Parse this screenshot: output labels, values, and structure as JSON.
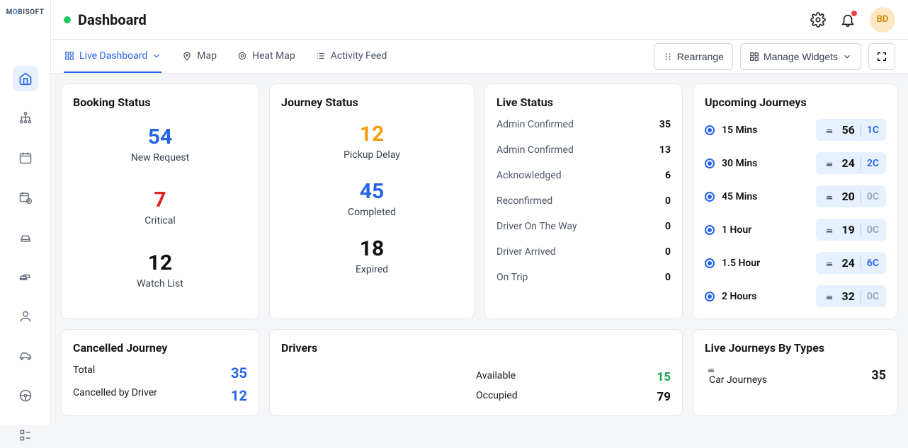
{
  "header": {
    "title": "Dashboard",
    "avatar": "BD"
  },
  "tabs": [
    {
      "label": "Live Dashboard"
    },
    {
      "label": "Map"
    },
    {
      "label": "Heat Map"
    },
    {
      "label": "Activity Feed"
    }
  ],
  "rearrange_label": "Rearrange",
  "manage_widgets_label": "Manage Widgets",
  "booking": {
    "title": "Booking Status",
    "items": [
      {
        "value": "54",
        "label": "New Request",
        "cls": "blue"
      },
      {
        "value": "7",
        "label": "Critical",
        "cls": "red"
      },
      {
        "value": "12",
        "label": "Watch List",
        "cls": "black"
      }
    ]
  },
  "journey": {
    "title": "Journey Status",
    "items": [
      {
        "value": "12",
        "label": "Pickup Delay",
        "cls": "orange"
      },
      {
        "value": "45",
        "label": "Completed",
        "cls": "blue"
      },
      {
        "value": "18",
        "label": "Expired",
        "cls": "black"
      }
    ]
  },
  "live": {
    "title": "Live Status",
    "rows": [
      {
        "k": "Admin Confirmed",
        "v": "35"
      },
      {
        "k": "Admin Confirmed",
        "v": "13"
      },
      {
        "k": "Acknowledged",
        "v": "6"
      },
      {
        "k": "Reconfirmed",
        "v": "0"
      },
      {
        "k": "Driver On The Way",
        "v": "0"
      },
      {
        "k": "Driver Arrived",
        "v": "0"
      },
      {
        "k": "On Trip",
        "v": "0"
      }
    ]
  },
  "upcoming": {
    "title": "Upcoming Journeys",
    "rows": [
      {
        "time": "15 Mins",
        "count": "56",
        "c": "1C",
        "ccls": "c-blue"
      },
      {
        "time": "30 Mins",
        "count": "24",
        "c": "2C",
        "ccls": "c-blue"
      },
      {
        "time": "45 Mins",
        "count": "20",
        "c": "0C",
        "ccls": "c-zero"
      },
      {
        "time": "1 Hour",
        "count": "19",
        "c": "0C",
        "ccls": "c-zero"
      },
      {
        "time": "1.5 Hour",
        "count": "24",
        "c": "6C",
        "ccls": "c-blue"
      },
      {
        "time": "2 Hours",
        "count": "32",
        "c": "0C",
        "ccls": "c-zero"
      }
    ]
  },
  "cancelled": {
    "title": "Cancelled Journey",
    "rows": [
      {
        "k": "Total",
        "v": "35"
      },
      {
        "k": "Cancelled by Driver",
        "v": "12"
      }
    ]
  },
  "drivers": {
    "title": "Drivers",
    "rows": [
      {
        "k": "Available",
        "v": "15",
        "cls": "green"
      },
      {
        "k": "Occupied",
        "v": "79",
        "cls": "dark"
      }
    ]
  },
  "ljt": {
    "title": "Live Journeys By Types",
    "rows": [
      {
        "k": "Car Journeys",
        "v": "35"
      }
    ]
  }
}
